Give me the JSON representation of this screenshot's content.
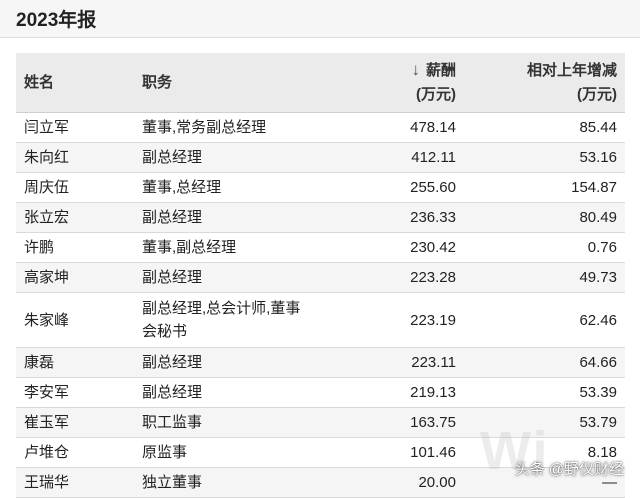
{
  "header": {
    "title": "2023年报"
  },
  "table": {
    "columns": {
      "name": "姓名",
      "role": "职务",
      "salary_line1": "薪酬",
      "salary_line2": "(万元)",
      "change_line1": "相对上年增减",
      "change_line2": "(万元)"
    },
    "sort_icon": "arrow-down-icon",
    "rows": [
      {
        "name": "闫立军",
        "role": "董事,常务副总经理",
        "salary": "478.14",
        "change": "85.44"
      },
      {
        "name": "朱向红",
        "role": "副总经理",
        "salary": "412.11",
        "change": "53.16"
      },
      {
        "name": "周庆伍",
        "role": "董事,总经理",
        "salary": "255.60",
        "change": "154.87"
      },
      {
        "name": "张立宏",
        "role": "副总经理",
        "salary": "236.33",
        "change": "80.49"
      },
      {
        "name": "许鹏",
        "role": "董事,副总经理",
        "salary": "230.42",
        "change": "0.76"
      },
      {
        "name": "高家坤",
        "role": "副总经理",
        "salary": "223.28",
        "change": "49.73"
      },
      {
        "name": "朱家峰",
        "role": "副总经理,总会计师,董事会秘书",
        "salary": "223.19",
        "change": "62.46"
      },
      {
        "name": "康磊",
        "role": "副总经理",
        "salary": "223.11",
        "change": "64.66"
      },
      {
        "name": "李安军",
        "role": "副总经理",
        "salary": "219.13",
        "change": "53.39"
      },
      {
        "name": "崔玉军",
        "role": "职工监事",
        "salary": "163.75",
        "change": "53.79"
      },
      {
        "name": "卢堆仓",
        "role": "原监事",
        "salary": "101.46",
        "change": "8.18"
      },
      {
        "name": "王瑞华",
        "role": "独立董事",
        "salary": "20.00",
        "change": "—"
      }
    ]
  },
  "watermark": {
    "background_text": "Wi",
    "source_text": "头条 @野仪财经"
  }
}
